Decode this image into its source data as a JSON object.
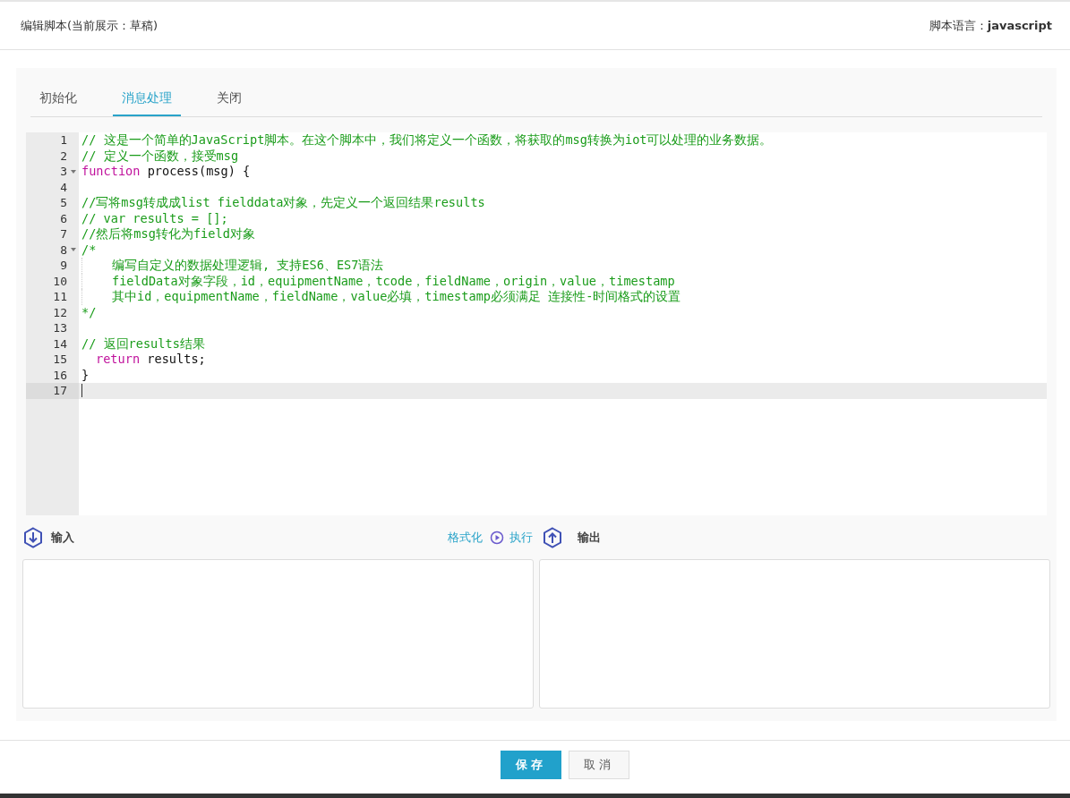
{
  "header": {
    "title": "编辑脚本(当前展示：草稿)",
    "language_label": "脚本语言：",
    "language_value": "javascript"
  },
  "tabs": [
    {
      "label": "初始化",
      "selected": false
    },
    {
      "label": "消息处理",
      "selected": true
    },
    {
      "label": "关闭",
      "selected": false
    }
  ],
  "editor": {
    "lines": [
      {
        "number": "1",
        "tokens": [
          {
            "kind": "comment",
            "text": "// 这是一个简单的JavaScript脚本。在这个脚本中，我们将定义一个函数，将获取的msg转换为iot可以处理的业务数据。"
          }
        ]
      },
      {
        "number": "2",
        "tokens": [
          {
            "kind": "comment",
            "text": "// 定义一个函数，接受msg"
          }
        ]
      },
      {
        "number": "3",
        "foldable": true,
        "tokens": [
          {
            "kind": "keyword",
            "text": "function"
          },
          {
            "kind": "plain",
            "text": " process(msg) {"
          }
        ]
      },
      {
        "number": "4"
      },
      {
        "number": "5",
        "tokens": [
          {
            "kind": "comment",
            "text": "//写将msg转成成list fielddata对象，先定义一个返回结果results"
          }
        ]
      },
      {
        "number": "6",
        "tokens": [
          {
            "kind": "comment",
            "text": "// var results = [];"
          }
        ]
      },
      {
        "number": "7",
        "tokens": [
          {
            "kind": "comment",
            "text": "//然后将msg转化为field对象"
          }
        ]
      },
      {
        "number": "8",
        "foldable": true,
        "tokens": [
          {
            "kind": "comment",
            "text": "/*"
          }
        ]
      },
      {
        "number": "9",
        "indented": true,
        "tokens": [
          {
            "kind": "comment",
            "text": "编写自定义的数据处理逻辑, 支持ES6、ES7语法"
          }
        ]
      },
      {
        "number": "10",
        "indented": true,
        "tokens": [
          {
            "kind": "comment",
            "text": "fieldData对象字段，id，equipmentName，tcode，fieldName，origin，value，timestamp"
          }
        ]
      },
      {
        "number": "11",
        "indented": true,
        "tokens": [
          {
            "kind": "comment",
            "text": "其中id，equipmentName，fieldName，value必填，timestamp必须满足 连接性-时间格式的设置"
          }
        ]
      },
      {
        "number": "12",
        "tokens": [
          {
            "kind": "comment",
            "text": "*/"
          }
        ]
      },
      {
        "number": "13"
      },
      {
        "number": "14",
        "tokens": [
          {
            "kind": "comment",
            "text": "// 返回results结果"
          }
        ]
      },
      {
        "number": "15",
        "tokens": [
          {
            "kind": "keyword",
            "text": "return"
          },
          {
            "kind": "plain",
            "text": " results;"
          }
        ],
        "indented_small": true
      },
      {
        "number": "16",
        "tokens": [
          {
            "kind": "plain",
            "text": "}"
          }
        ]
      },
      {
        "number": "17",
        "active": true
      }
    ]
  },
  "io": {
    "input_label": "输入",
    "format_link": "格式化",
    "run_link": "执行",
    "output_label": "输出"
  },
  "buttons": [
    {
      "kind": "primary",
      "label": "保存"
    },
    {
      "kind": "default",
      "label": "取消"
    }
  ]
}
